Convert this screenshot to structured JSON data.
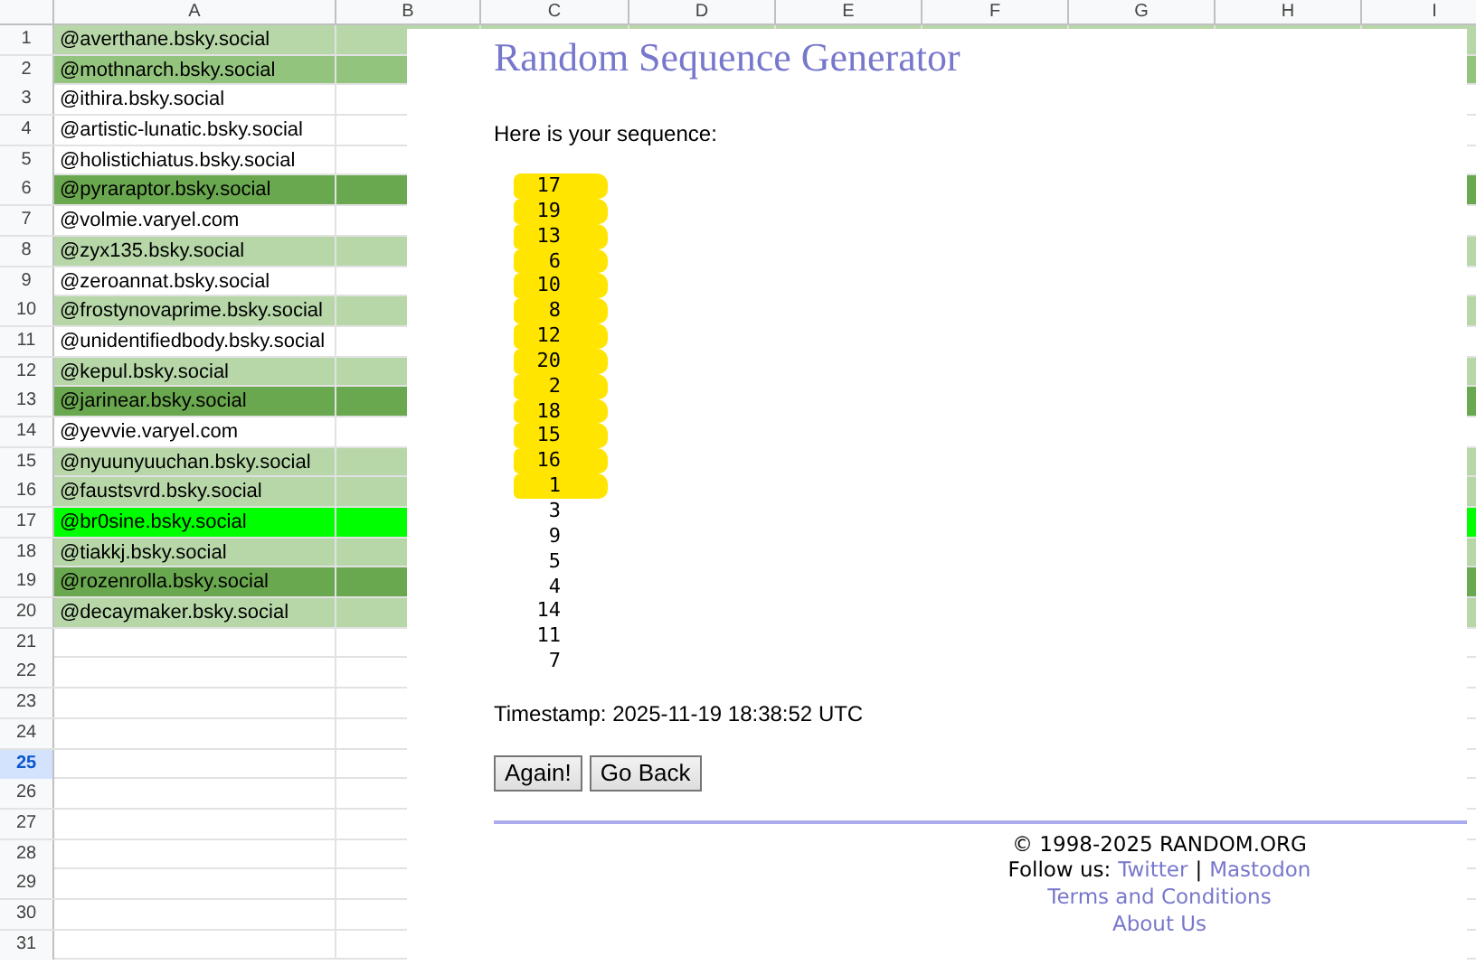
{
  "sheet": {
    "columns": [
      "A",
      "B",
      "C",
      "D",
      "E",
      "F",
      "G",
      "H",
      "I"
    ],
    "rows": [
      {
        "number": "1",
        "text": "@averthane.bsky.social",
        "color": "#b7d7a8",
        "selected": false
      },
      {
        "number": "2",
        "text": "@mothnarch.bsky.social",
        "color": "#93c47d",
        "selected": false
      },
      {
        "number": "3",
        "text": "@ithira.bsky.social",
        "selected": false
      },
      {
        "number": "4",
        "text": "@artistic-lunatic.bsky.social",
        "selected": false
      },
      {
        "number": "5",
        "text": "@holistichiatus.bsky.social",
        "selected": false
      },
      {
        "number": "6",
        "text": "@pyraraptor.bsky.social",
        "color": "#6aa84f",
        "selected": false
      },
      {
        "number": "7",
        "text": "@volmie.varyel.com",
        "selected": false
      },
      {
        "number": "8",
        "text": "@zyx135.bsky.social",
        "color": "#b7d7a8",
        "selected": false
      },
      {
        "number": "9",
        "text": "@zeroannat.bsky.social",
        "selected": false
      },
      {
        "number": "10",
        "text": "@frostynovaprime.bsky.social",
        "color": "#b7d7a8",
        "selected": false
      },
      {
        "number": "11",
        "text": "@unidentifiedbody.bsky.social",
        "selected": false
      },
      {
        "number": "12",
        "text": "@kepul.bsky.social",
        "color": "#b7d7a8",
        "selected": false
      },
      {
        "number": "13",
        "text": "@jarinear.bsky.social",
        "color": "#6aa84f",
        "selected": false
      },
      {
        "number": "14",
        "text": "@yevvie.varyel.com",
        "selected": false
      },
      {
        "number": "15",
        "text": "@nyuunyuuchan.bsky.social",
        "color": "#b7d7a8",
        "selected": false
      },
      {
        "number": "16",
        "text": "@faustsvrd.bsky.social",
        "color": "#b7d7a8",
        "selected": false
      },
      {
        "number": "17",
        "text": "@br0sine.bsky.social",
        "color": "#00ff00",
        "selected": false
      },
      {
        "number": "18",
        "text": "@tiakkj.bsky.social",
        "color": "#b7d7a8",
        "selected": false
      },
      {
        "number": "19",
        "text": "@rozenrolla.bsky.social",
        "color": "#6aa84f",
        "selected": false
      },
      {
        "number": "20",
        "text": "@decaymaker.bsky.social",
        "color": "#b7d7a8",
        "selected": false
      },
      {
        "number": "21",
        "selected": false
      },
      {
        "number": "22",
        "selected": false
      },
      {
        "number": "23",
        "selected": false
      },
      {
        "number": "24",
        "selected": false
      },
      {
        "number": "25",
        "selected": true
      },
      {
        "number": "26",
        "selected": false
      },
      {
        "number": "27",
        "selected": false
      },
      {
        "number": "28",
        "selected": false
      },
      {
        "number": "29",
        "selected": false
      },
      {
        "number": "30",
        "selected": false
      },
      {
        "number": "31",
        "selected": false
      }
    ]
  },
  "page": {
    "title": "Random Sequence Generator",
    "intro": "Here is your sequence:",
    "sequence": [
      {
        "value": "17",
        "highlighted": true
      },
      {
        "value": "19",
        "highlighted": true
      },
      {
        "value": "13",
        "highlighted": true
      },
      {
        "value": "6",
        "highlighted": true
      },
      {
        "value": "10",
        "highlighted": true
      },
      {
        "value": "8",
        "highlighted": true
      },
      {
        "value": "12",
        "highlighted": true
      },
      {
        "value": "20",
        "highlighted": true
      },
      {
        "value": "2",
        "highlighted": true
      },
      {
        "value": "18",
        "highlighted": true
      },
      {
        "value": "15",
        "highlighted": true
      },
      {
        "value": "16",
        "highlighted": true
      },
      {
        "value": "1",
        "highlighted": true
      },
      {
        "value": "3",
        "highlighted": false
      },
      {
        "value": "9",
        "highlighted": false
      },
      {
        "value": "5",
        "highlighted": false
      },
      {
        "value": "4",
        "highlighted": false
      },
      {
        "value": "14",
        "highlighted": false
      },
      {
        "value": "11",
        "highlighted": false
      },
      {
        "value": "7",
        "highlighted": false
      }
    ],
    "timestamp": "Timestamp: 2025-11-19 18:38:52 UTC",
    "buttons": [
      "Again!",
      "Go Back"
    ],
    "footer": {
      "copyright": "© 1998-2025 RANDOM.ORG",
      "follow_label": "Follow us:",
      "links": [
        "Twitter",
        "Mastodon"
      ],
      "separator": "|",
      "terms": "Terms and Conditions",
      "about": "About Us"
    }
  }
}
